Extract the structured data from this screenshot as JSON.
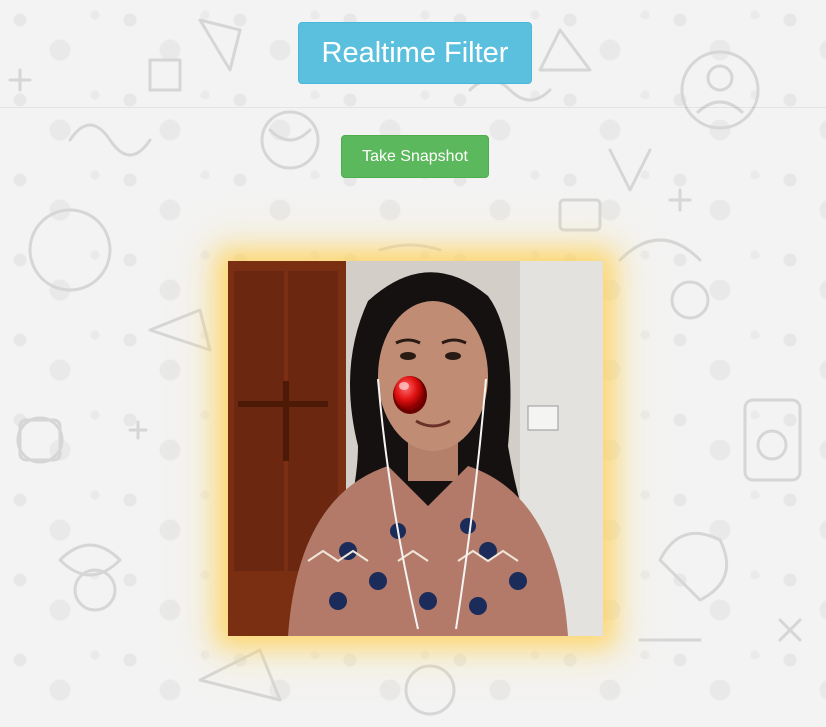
{
  "header": {
    "title": "Realtime Filter"
  },
  "actions": {
    "snapshot_label": "Take Snapshot"
  },
  "filter": {
    "name": "red-nose",
    "color": "#e01010"
  },
  "colors": {
    "title_bg": "#5bc0de",
    "button_bg": "#5cb85c",
    "frame_glow": "#ffd25a",
    "page_bg": "#f3f3f3"
  }
}
